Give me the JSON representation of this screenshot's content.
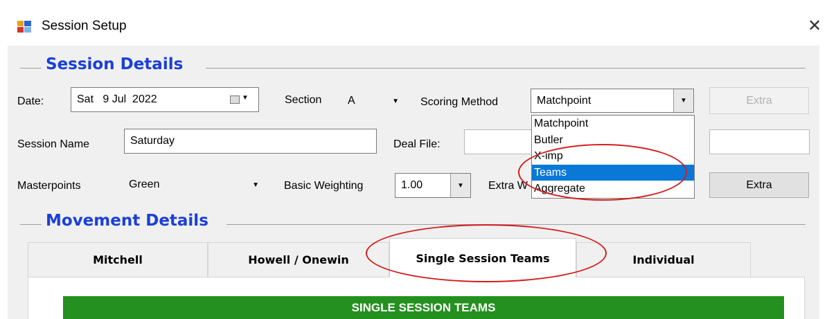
{
  "window": {
    "title": "Session Setup",
    "close_glyph": "✕",
    "icon": "app-window-icon"
  },
  "session_details": {
    "heading": "Session Details",
    "date": {
      "label": "Date:",
      "value": "Sat   9 Jul  2022",
      "picker_icon": "calendar-icon"
    },
    "section": {
      "label": "Section",
      "value": "A"
    },
    "scoring_method": {
      "label": "Scoring Method",
      "value": "Matchpoint",
      "options": [
        "Matchpoint",
        "Butler",
        "X-imp",
        "Teams",
        "Aggregate"
      ],
      "highlighted_option": "Teams"
    },
    "extra_top": "Extra",
    "session_name": {
      "label": "Session Name",
      "value": "Saturday"
    },
    "deal_file": {
      "label": "Deal File:",
      "value": ""
    },
    "masterpoints": {
      "label": "Masterpoints",
      "value": "Green"
    },
    "basic_weighting": {
      "label": "Basic Weighting",
      "value": "1.00"
    },
    "extra_weighting_label": "Extra W",
    "extra_bottom": "Extra"
  },
  "movement_details": {
    "heading": "Movement Details",
    "tabs": [
      "Mitchell",
      "Howell / Onewin",
      "Single Session Teams",
      "Individual"
    ],
    "active_tab": "Single Session Teams",
    "banner": "SINGLE SESSION TEAMS"
  },
  "annotations": {
    "ellipse_color": "#d41c1c"
  },
  "colors": {
    "heading": "#1a3fd8",
    "selection": "#0a78d7",
    "banner": "#24901f"
  }
}
